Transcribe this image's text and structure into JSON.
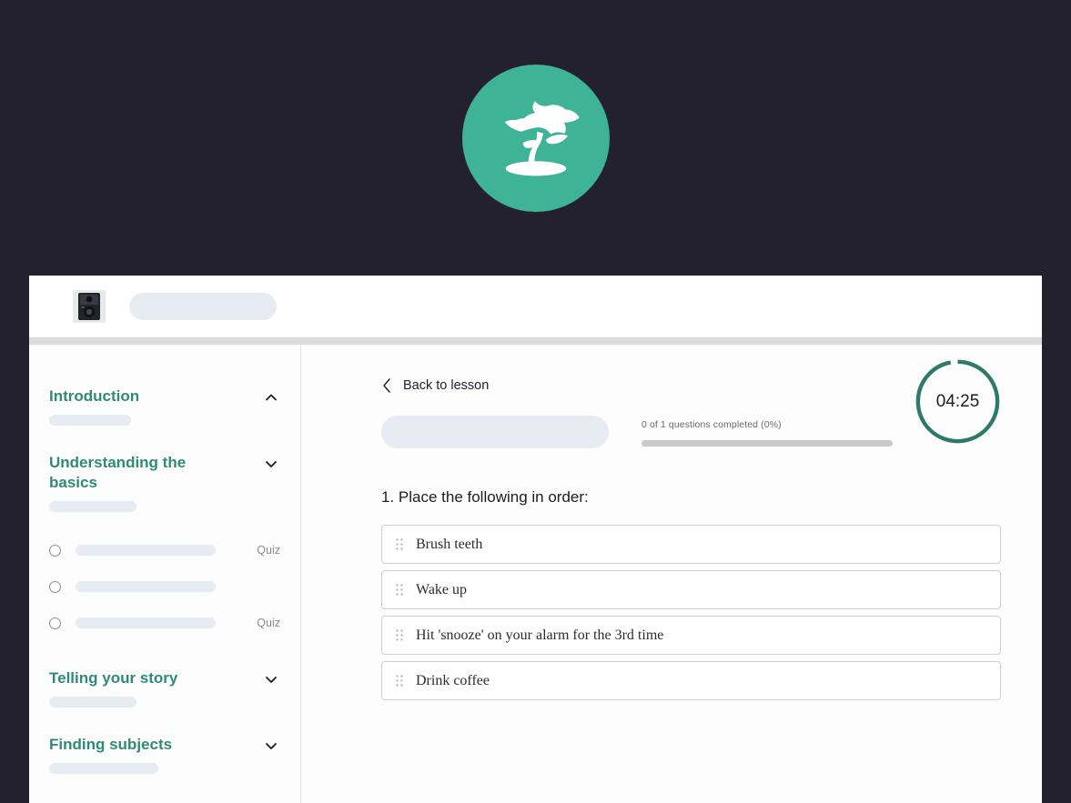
{
  "theme": {
    "page_background": "#24212e",
    "brand_teal": "#3fb395",
    "heading_teal": "#2e8b77",
    "timer_ring": "#2d7a6b",
    "skeleton": "#e6ecf2",
    "panel": "#fdfdfd"
  },
  "splash": {
    "logo_icon": "bonsai-tree-icon",
    "logo_background": "#3fb395"
  },
  "topbar": {
    "thumbnail_icon": "camera-thumbnail-icon",
    "title_placeholder": ""
  },
  "sidebar": {
    "sections": [
      {
        "title": "Introduction",
        "chevron": "chevron-up-icon",
        "expanded": true,
        "skeleton_width": "w90",
        "lessons": []
      },
      {
        "title": "Understanding the basics",
        "chevron": "chevron-down-icon",
        "expanded": false,
        "skeleton_width": "w96",
        "lessons": [
          {
            "state_icon": "radio-unchecked-icon",
            "label": "",
            "tag": "Quiz"
          },
          {
            "state_icon": "radio-unchecked-icon",
            "label": "",
            "tag": ""
          },
          {
            "state_icon": "radio-unchecked-icon",
            "label": "",
            "tag": "Quiz"
          }
        ]
      },
      {
        "title": "Telling your story",
        "chevron": "chevron-down-icon",
        "expanded": false,
        "skeleton_width": "w96",
        "lessons": []
      },
      {
        "title": "Finding subjects",
        "chevron": "chevron-down-icon",
        "expanded": false,
        "skeleton_width": "w120",
        "lessons": []
      }
    ]
  },
  "main": {
    "back_label": "Back to lesson",
    "back_icon": "chevron-left-icon",
    "quiz_title_placeholder": "",
    "progress": {
      "label": "0 of 1 questions completed (0%)",
      "percent": 0,
      "completed": 0,
      "total": 1
    },
    "timer": {
      "value": "04:25",
      "ring_percent": 97
    },
    "question": {
      "number": "1.",
      "text": "Place the following in order:",
      "full": "1. Place the following in order:"
    },
    "order_items": [
      {
        "handle_icon": "drag-handle-icon",
        "text": "Brush teeth"
      },
      {
        "handle_icon": "drag-handle-icon",
        "text": "Wake up"
      },
      {
        "handle_icon": "drag-handle-icon",
        "text": "Hit 'snooze' on your alarm for the 3rd time"
      },
      {
        "handle_icon": "drag-handle-icon",
        "text": "Drink coffee"
      }
    ]
  }
}
